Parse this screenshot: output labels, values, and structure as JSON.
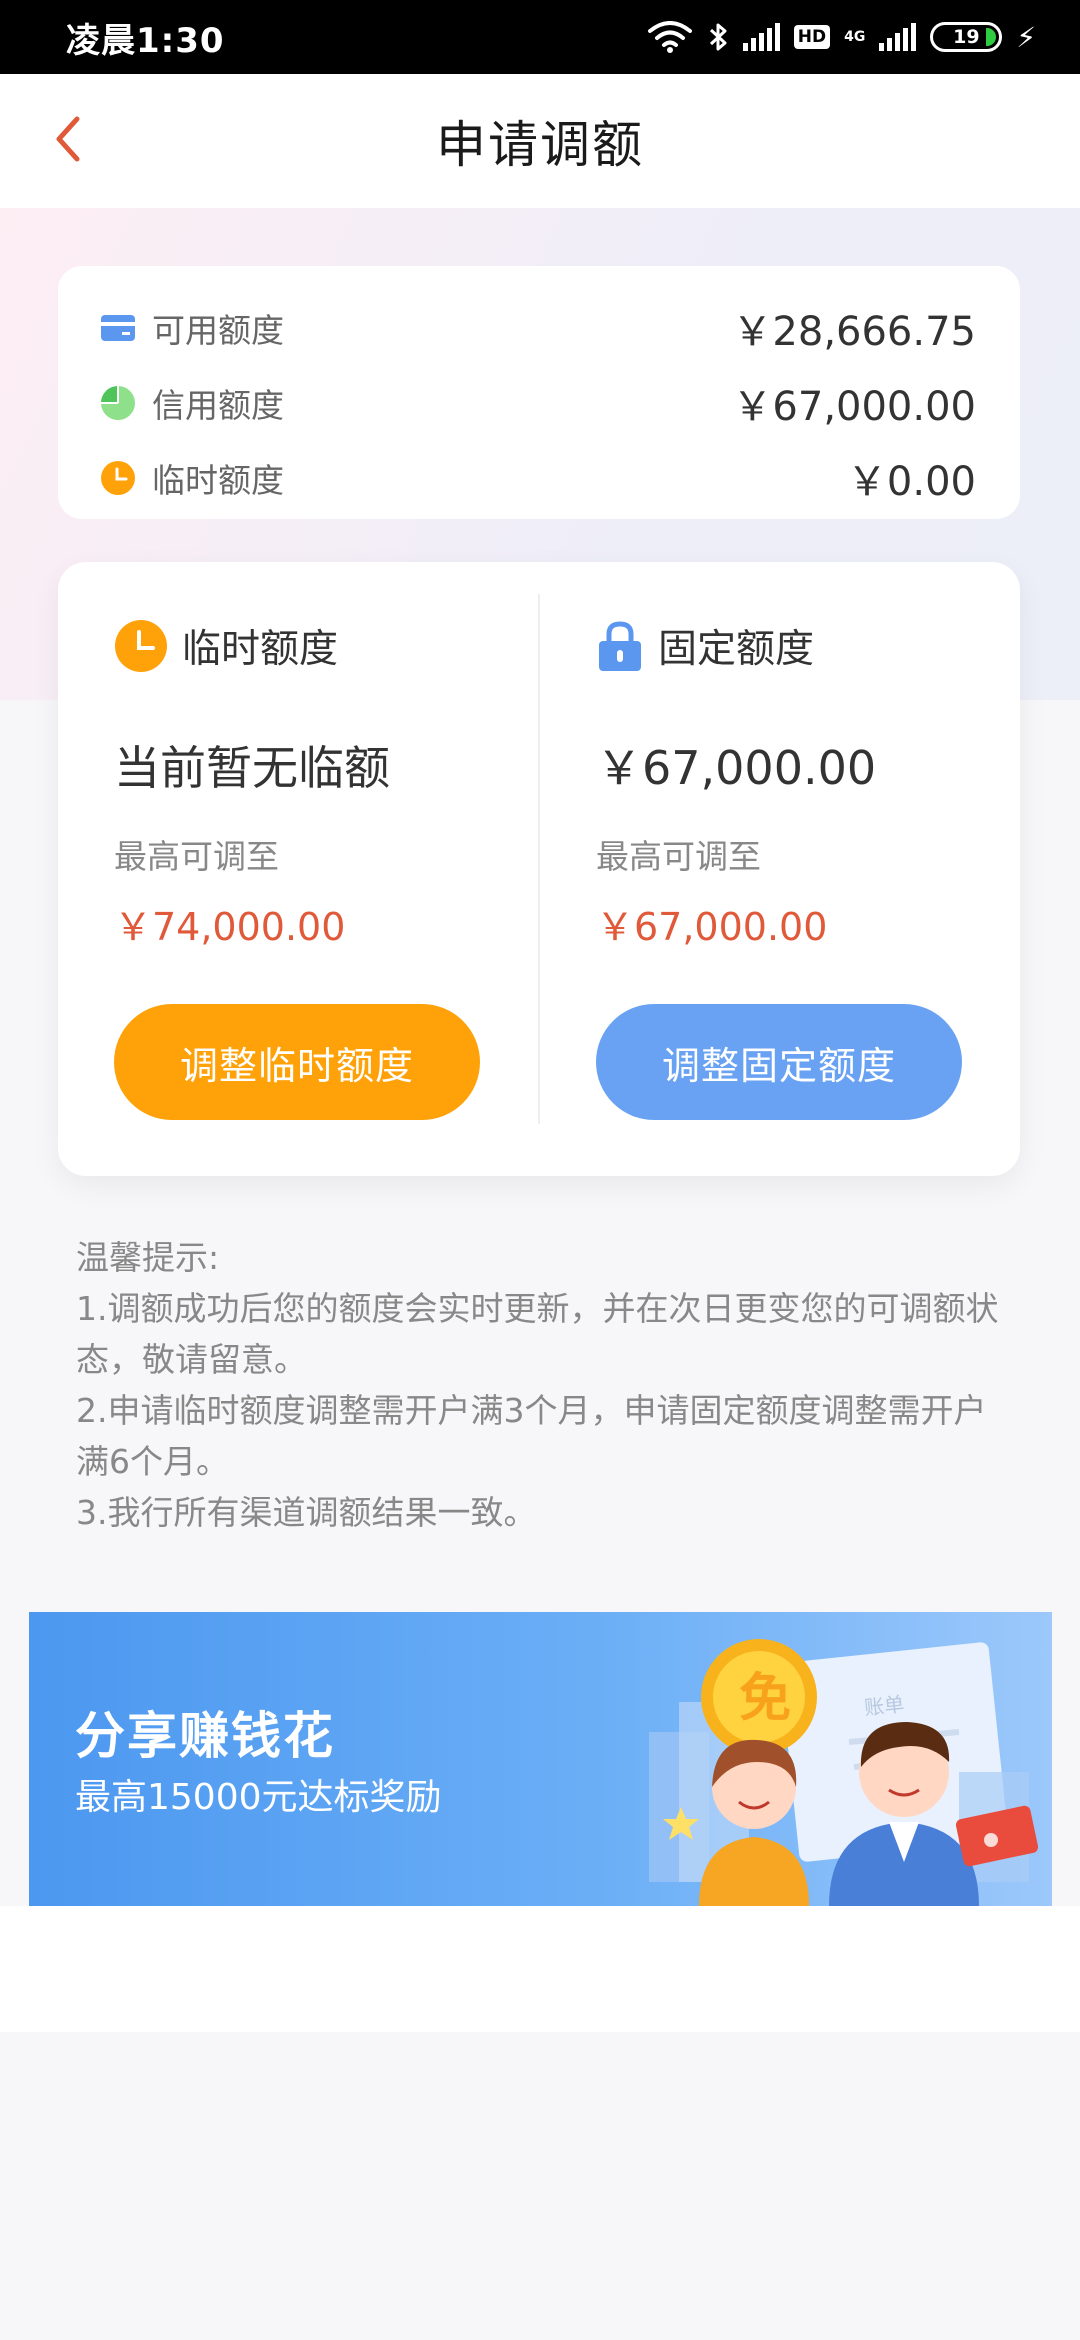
{
  "status_bar": {
    "time": "凌晨1:30",
    "hd": "HD",
    "net": "4G",
    "battery": "19"
  },
  "header": {
    "title": "申请调额",
    "back_icon": "chevron-left-icon"
  },
  "summary": {
    "rows": [
      {
        "icon": "card-icon",
        "label": "可用额度",
        "value": "￥28,666.75"
      },
      {
        "icon": "pie-chart-icon",
        "label": "信用额度",
        "value": "￥67,000.00"
      },
      {
        "icon": "clock-icon",
        "label": "临时额度",
        "value": "￥0.00"
      }
    ]
  },
  "temporary": {
    "icon": "clock-icon",
    "label": "临时额度",
    "status": "当前暂无临额",
    "max_label": "最高可调至",
    "max_value": "￥74,000.00",
    "button": "调整临时额度"
  },
  "fixed": {
    "icon": "lock-icon",
    "label": "固定额度",
    "current": "￥67,000.00",
    "max_label": "最高可调至",
    "max_value": "￥67,000.00",
    "button": "调整固定额度"
  },
  "tips": {
    "title": "温馨提示:",
    "line1": "1.调额成功后您的额度会实时更新，并在次日更变您的可调额状态，敬请留意。",
    "line2": "2.申请临时额度调整需开户满3个月，申请固定额度调整需开户满6个月。",
    "line3": "3.我行所有渠道调额结果一致。"
  },
  "banner": {
    "title": "分享赚钱花",
    "subtitle": "最高15000元达标奖励",
    "coin_text": "免",
    "paper_text": "账单"
  },
  "colors": {
    "accent_red": "#e05a3a",
    "orange_button": "#ffa20a",
    "blue_button": "#6aa2f3",
    "banner_blue": "#4c98f0"
  }
}
